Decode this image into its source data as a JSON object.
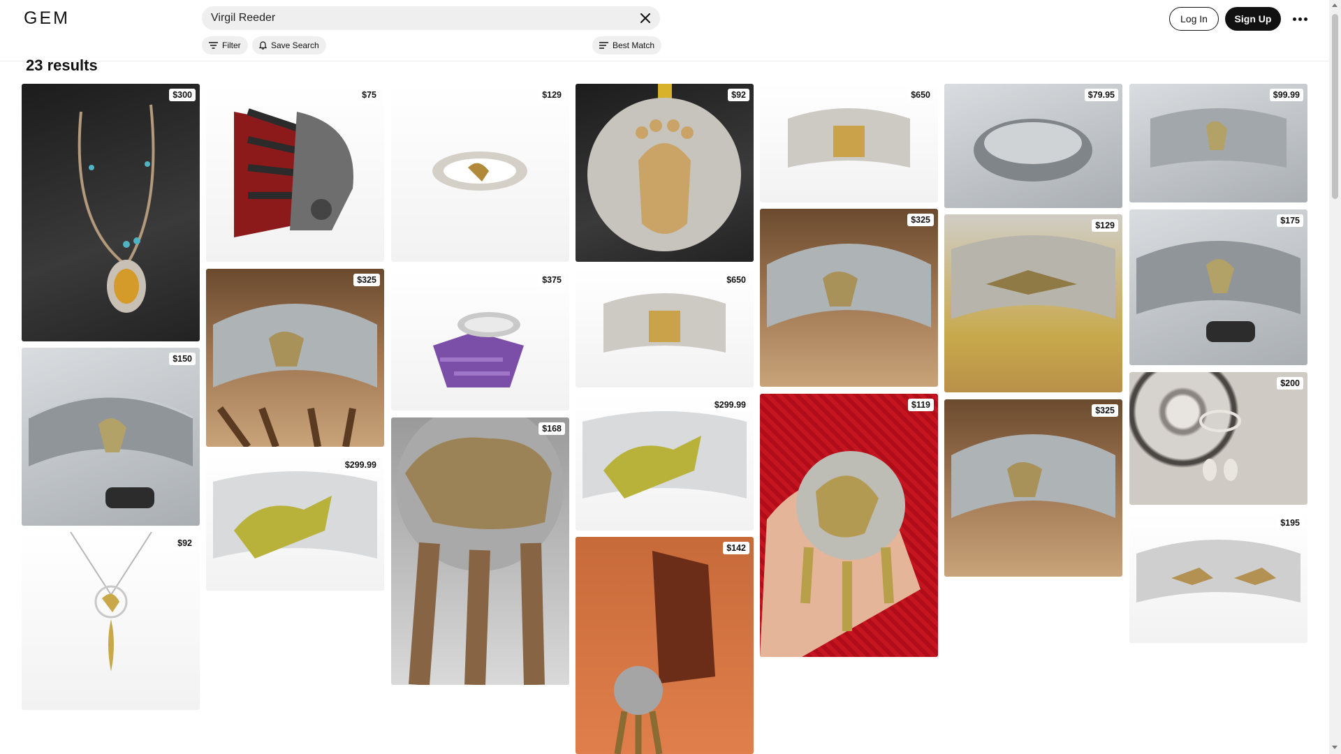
{
  "header": {
    "logo": "GEM",
    "search_value": "Virgil Reeder",
    "filter_label": "Filter",
    "save_search_label": "Save Search",
    "sort_label": "Best Match",
    "login_label": "Log In",
    "signup_label": "Sign Up"
  },
  "results_label": "23 results",
  "cards": [
    {
      "price": "$300"
    },
    {
      "price": "$150"
    },
    {
      "price": "$92"
    },
    {
      "price": "$75"
    },
    {
      "price": "$325"
    },
    {
      "price": "$299.99"
    },
    {
      "price": "$129"
    },
    {
      "price": "$375"
    },
    {
      "price": "$168"
    },
    {
      "price": "$92"
    },
    {
      "price": "$650"
    },
    {
      "price": "$299.99"
    },
    {
      "price": "$142"
    },
    {
      "price": "$650"
    },
    {
      "price": "$325"
    },
    {
      "price": "$119"
    },
    {
      "price": "$79.95"
    },
    {
      "price": "$129"
    },
    {
      "price": "$325"
    },
    {
      "price": "$99.99"
    },
    {
      "price": "$175"
    },
    {
      "price": "$200"
    },
    {
      "price": "$195"
    }
  ],
  "icons": {
    "filter": "filter-icon",
    "save": "bell-icon",
    "sort": "sort-icon",
    "clear": "close-icon",
    "more": "more-horizontal-icon"
  }
}
